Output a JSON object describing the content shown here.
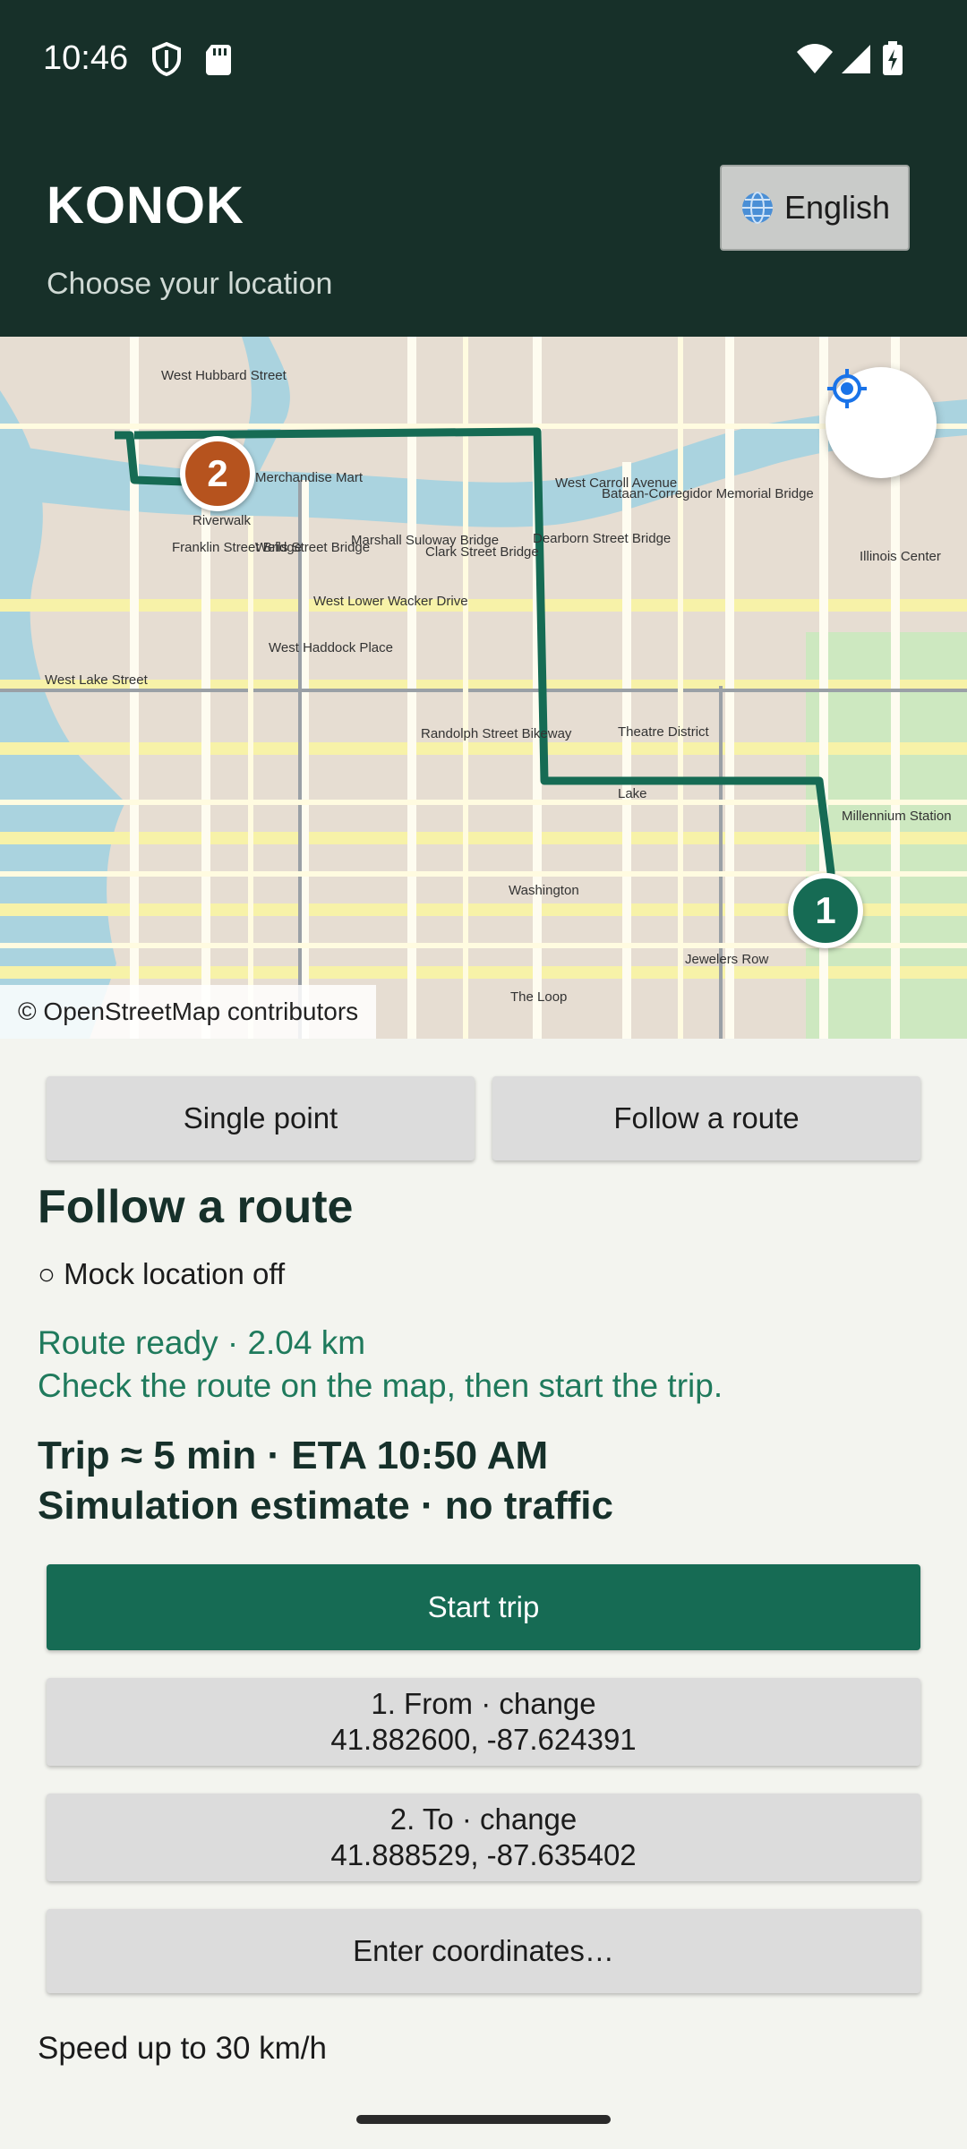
{
  "status_bar": {
    "time": "10:46"
  },
  "app": {
    "title": "KONOK",
    "subtitle": "Choose your location",
    "language_button": "English"
  },
  "map": {
    "attribution": "© OpenStreetMap contributors",
    "marker_1": "1",
    "marker_2": "2",
    "route_color": "#166b54",
    "labels": [
      "West Hubbard Street",
      "Merchandise Mart",
      "Riverwalk",
      "Franklin Street Bridge",
      "Wells Street Bridge",
      "Marshall Suloway Bridge",
      "Clark Street Bridge",
      "Dearborn Street Bridge",
      "Bataan-Corregidor Memorial Bridge",
      "West Carroll Avenue",
      "West Lower Wacker Drive",
      "West Lake Street",
      "Theatre District",
      "Lake",
      "Randolph Street Bikeway",
      "Washington",
      "The Loop",
      "Millennium Station",
      "Illinois Center",
      "Jewelers Row",
      "West Haddock Place"
    ]
  },
  "modes": {
    "single_point": "Single point",
    "follow_route": "Follow a route"
  },
  "section": {
    "title": "Follow a route",
    "mock_status": "○ Mock location off",
    "route_ready_line1": "Route ready · 2.04 km",
    "route_ready_line2": "Check the route on the map, then start the trip.",
    "trip_line1": "Trip ≈ 5 min · ETA 10:50 AM",
    "trip_line2": "Simulation estimate · no traffic"
  },
  "buttons": {
    "start_trip": "Start trip",
    "from_label": "1. From · change",
    "from_coords": "41.882600, -87.624391",
    "to_label": "2. To · change",
    "to_coords": "41.888529, -87.635402",
    "enter_coords": "Enter coordinates…"
  },
  "speed_text": "Speed up to 30 km/h"
}
